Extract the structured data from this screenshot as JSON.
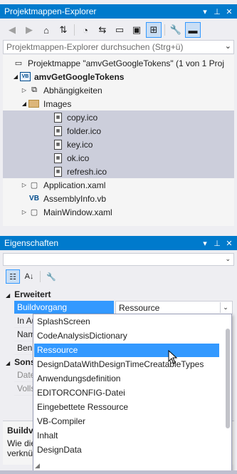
{
  "solution_explorer": {
    "title": "Projektmappen-Explorer",
    "search_placeholder": "Projektmappen-Explorer durchsuchen (Strg+ü)",
    "tree": [
      {
        "label": "Projektmappe \"amvGetGoogleTokens\" (1 von 1 Proj",
        "icon": "solution-icon",
        "bold": false
      },
      {
        "label": "amvGetGoogleTokens",
        "icon": "vb-project-icon",
        "bold": true
      },
      {
        "label": "Abhängigkeiten",
        "icon": "dependencies-icon",
        "bold": false
      },
      {
        "label": "Images",
        "icon": "folder-icon",
        "bold": false
      },
      {
        "label": "copy.ico",
        "icon": "ico-file-icon",
        "bold": false
      },
      {
        "label": "folder.ico",
        "icon": "ico-file-icon",
        "bold": false
      },
      {
        "label": "key.ico",
        "icon": "ico-file-icon",
        "bold": false
      },
      {
        "label": "ok.ico",
        "icon": "ico-file-icon",
        "bold": false
      },
      {
        "label": "refresh.ico",
        "icon": "ico-file-icon",
        "bold": false
      },
      {
        "label": "Application.xaml",
        "icon": "xaml-icon",
        "bold": false
      },
      {
        "label": "AssemblyInfo.vb",
        "icon": "vb-file-icon",
        "bold": false
      },
      {
        "label": "MainWindow.xaml",
        "icon": "xaml-icon",
        "bold": false
      }
    ]
  },
  "properties": {
    "title": "Eigenschaften",
    "category_erweitert": "Erweitert",
    "category_sonst": "Sons",
    "rows": [
      {
        "name": "Buildvorgang",
        "value": "Ressource"
      },
      {
        "name": "In Au",
        "value": ""
      },
      {
        "name": "Nam",
        "value": ""
      },
      {
        "name": "Benu",
        "value": ""
      },
      {
        "name": "Date",
        "value": ""
      },
      {
        "name": "Volls",
        "value": ""
      }
    ],
    "desc_title": "Buildv",
    "desc_text_1": "Wie die",
    "desc_text_2": "verknü"
  },
  "dropdown_options": [
    "SplashScreen",
    "CodeAnalysisDictionary",
    "Ressource",
    "DesignDataWithDesignTimeCreatableTypes",
    "Anwendungsdefinition",
    "EDITORCONFIG-Datei",
    "Eingebettete Ressource",
    "VB-Compiler",
    "Inhalt",
    "DesignData"
  ],
  "dropdown_selected": "Ressource",
  "colors": {
    "active_title": "#007acc",
    "inactive_title": "#1c97ea",
    "selection": "#3399ff"
  }
}
